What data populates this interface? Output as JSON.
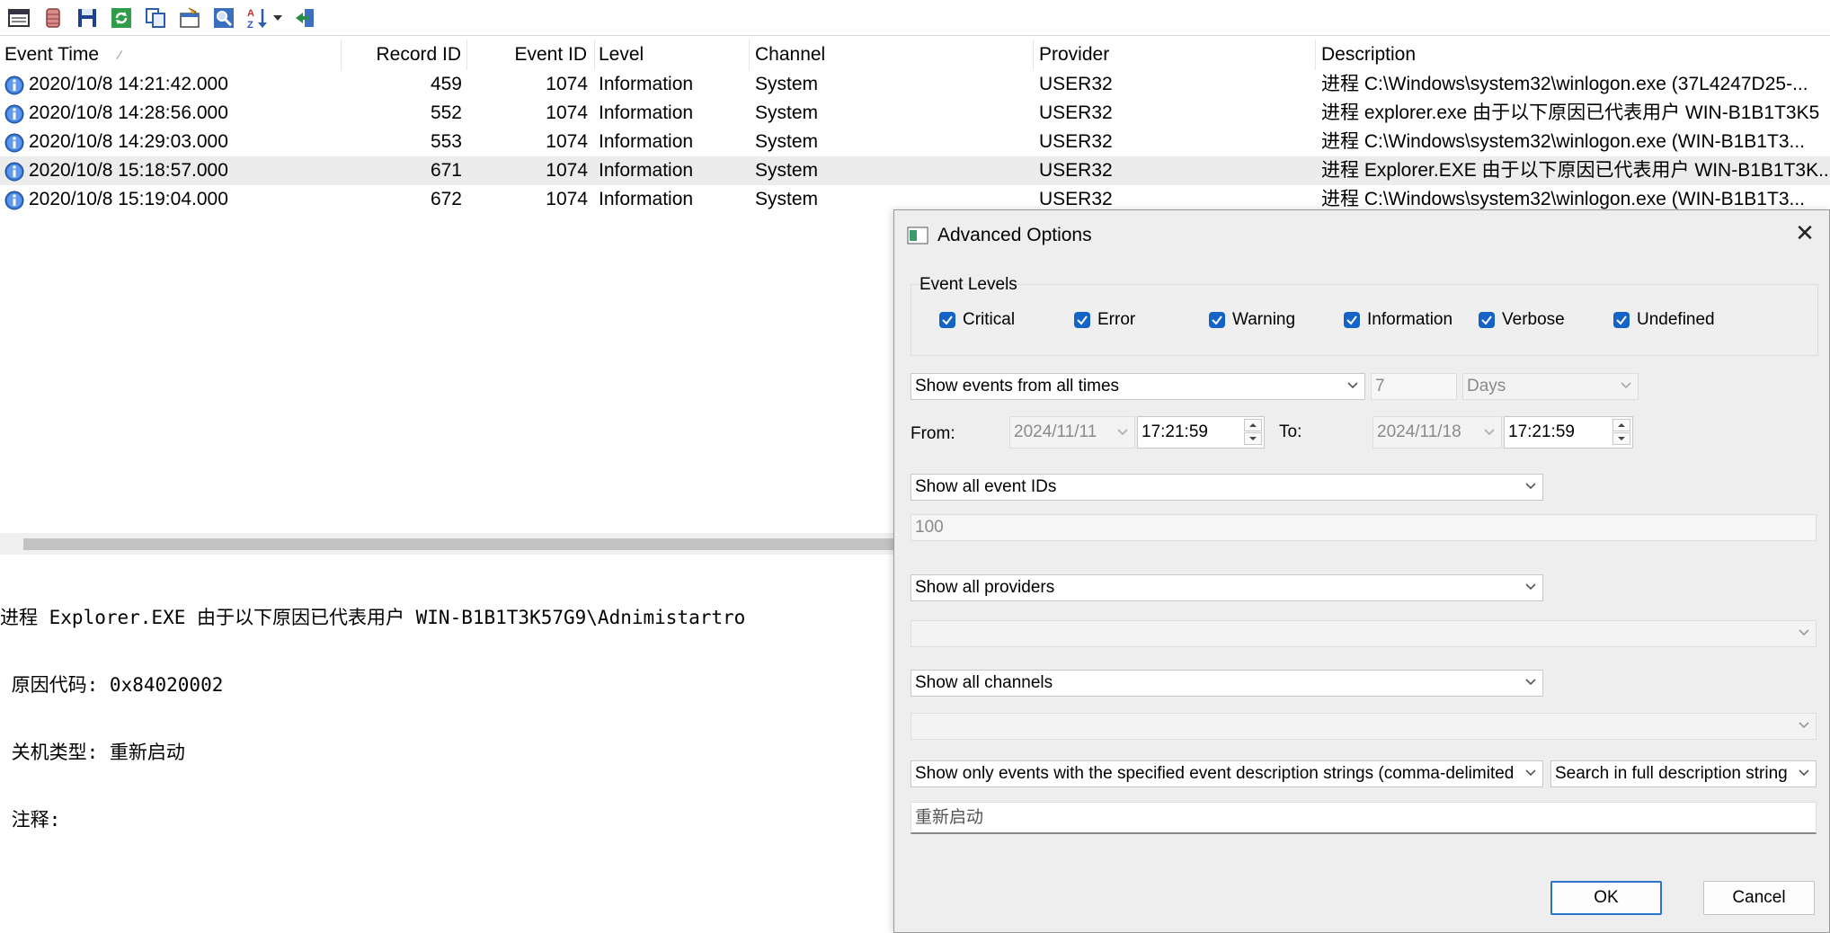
{
  "toolbar": {
    "icons": [
      "new-window-icon",
      "database-icon",
      "save-icon",
      "refresh-icon",
      "copy-icon",
      "properties-icon",
      "find-icon",
      "sort-icon",
      "dropdown-arrow-icon",
      "exit-icon"
    ]
  },
  "table": {
    "columns": [
      {
        "label": "Event Time"
      },
      {
        "label": "Record ID"
      },
      {
        "label": "Event ID"
      },
      {
        "label": "Level"
      },
      {
        "label": "Channel"
      },
      {
        "label": "Provider"
      },
      {
        "label": "Description"
      }
    ],
    "rows": [
      {
        "time": "2020/10/8 14:21:42.000",
        "record": "459",
        "event": "1074",
        "level": "Information",
        "channel": "System",
        "provider": "USER32",
        "desc": "进程 C:\\Windows\\system32\\winlogon.exe (37L4247D25-..."
      },
      {
        "time": "2020/10/8 14:28:56.000",
        "record": "552",
        "event": "1074",
        "level": "Information",
        "channel": "System",
        "provider": "USER32",
        "desc": "进程 explorer.exe 由于以下原因已代表用户 WIN-B1B1T3K5"
      },
      {
        "time": "2020/10/8 14:29:03.000",
        "record": "553",
        "event": "1074",
        "level": "Information",
        "channel": "System",
        "provider": "USER32",
        "desc": "进程 C:\\Windows\\system32\\winlogon.exe (WIN-B1B1T3..."
      },
      {
        "time": "2020/10/8 15:18:57.000",
        "record": "671",
        "event": "1074",
        "level": "Information",
        "channel": "System",
        "provider": "USER32",
        "desc": "进程 Explorer.EXE 由于以下原因已代表用户 WIN-B1B1T3K..."
      },
      {
        "time": "2020/10/8 15:19:04.000",
        "record": "672",
        "event": "1074",
        "level": "Information",
        "channel": "System",
        "provider": "USER32",
        "desc": "进程 C:\\Windows\\system32\\winlogon.exe (WIN-B1B1T3..."
      }
    ]
  },
  "detail": {
    "line1": "进程 Explorer.EXE 由于以下原因已代表用户 WIN-B1B1T3K57G9\\Adnimistartro",
    "line2": " 原因代码: 0x84020002",
    "line3": " 关机类型: 重新启动",
    "line4": " 注释:"
  },
  "dialog": {
    "title": "Advanced Options",
    "levels_label": "Event Levels",
    "levels": [
      {
        "label": "Critical",
        "checked": true
      },
      {
        "label": "Error",
        "checked": true
      },
      {
        "label": "Warning",
        "checked": true
      },
      {
        "label": "Information",
        "checked": true
      },
      {
        "label": "Verbose",
        "checked": true
      },
      {
        "label": "Undefined",
        "checked": true
      }
    ],
    "time_filter": "Show events from all times",
    "time_amount": "7",
    "time_unit": "Days",
    "from_label": "From:",
    "from_date": "2024/11/11",
    "from_time": "17:21:59",
    "to_label": "To:",
    "to_date": "2024/11/18",
    "to_time": "17:21:59",
    "event_ids_filter": "Show all event IDs",
    "event_ids_value": "100",
    "providers_filter": "Show all providers",
    "providers_value": "",
    "channels_filter": "Show all channels",
    "channels_value": "",
    "desc_filter": "Show only events with the specified event description strings (comma-delimited",
    "desc_search_mode": "Search in full description string (",
    "desc_value": "重新启动",
    "ok_label": "OK",
    "cancel_label": "Cancel"
  },
  "colors": {
    "accent": "#1463c6",
    "selected_row": "#ececec",
    "dialog_bg": "#eeeeee"
  }
}
